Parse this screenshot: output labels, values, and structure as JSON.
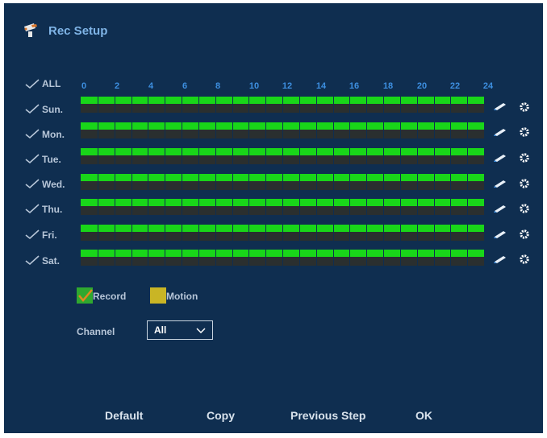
{
  "header": {
    "title": "Rec Setup",
    "icon": "camera-icon"
  },
  "schedule": {
    "all_label": "ALL",
    "hours": [
      "0",
      "2",
      "4",
      "6",
      "8",
      "10",
      "12",
      "14",
      "16",
      "18",
      "20",
      "22",
      "24"
    ],
    "days": [
      {
        "label": "Sun.",
        "checked": true,
        "recorded_fraction": 1.0
      },
      {
        "label": "Mon.",
        "checked": true,
        "recorded_fraction": 1.0
      },
      {
        "label": "Tue.",
        "checked": true,
        "recorded_fraction": 1.0
      },
      {
        "label": "Wed.",
        "checked": true,
        "recorded_fraction": 1.0
      },
      {
        "label": "Thu.",
        "checked": true,
        "recorded_fraction": 1.0
      },
      {
        "label": "Fri.",
        "checked": true,
        "recorded_fraction": 1.0
      },
      {
        "label": "Sat.",
        "checked": true,
        "recorded_fraction": 1.0
      }
    ]
  },
  "legend": {
    "record_label": "Record",
    "motion_label": "Motion",
    "record_color": "#2fa82f",
    "motion_color": "#c9b525"
  },
  "channel": {
    "label": "Channel",
    "value": "All"
  },
  "buttons": {
    "default": "Default",
    "copy": "Copy",
    "previous": "Previous Step",
    "ok": "OK"
  },
  "colors": {
    "background": "#0f2e50",
    "record_fill": "#19d619",
    "empty_fill": "#2a2f2f",
    "accent": "#3d8fe0"
  }
}
